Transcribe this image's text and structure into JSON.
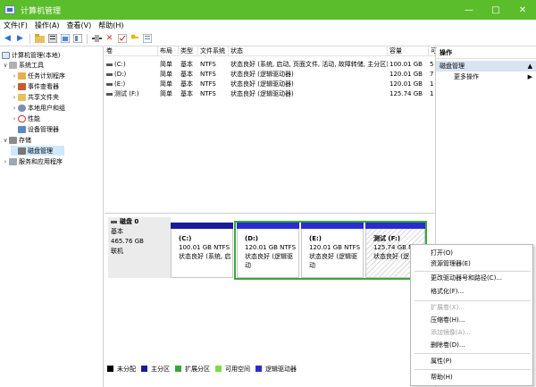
{
  "window": {
    "title": "计算机管理",
    "buttons": {
      "minimize": "—",
      "maximize": "□",
      "close": "✕"
    }
  },
  "menu": [
    "文件(F)",
    "操作(A)",
    "查看(V)",
    "帮助(H)"
  ],
  "toolbar_icons": [
    "back-arrow-icon",
    "forward-arrow-icon",
    "up-folder-icon",
    "properties-icon",
    "help-icon",
    "view-icon",
    "connect-icon",
    "delete-icon",
    "checklist-icon",
    "key-icon",
    "view-list-icon"
  ],
  "tree": {
    "items": [
      {
        "label": "计算机管理(本地)",
        "level": 0
      },
      {
        "label": "系统工具",
        "level": 1,
        "caret": "∨"
      },
      {
        "label": "任务计划程序",
        "level": 2,
        "caret": "›"
      },
      {
        "label": "事件查看器",
        "level": 2,
        "caret": "›"
      },
      {
        "label": "共享文件夹",
        "level": 2,
        "caret": "›"
      },
      {
        "label": "本地用户和组",
        "level": 2,
        "caret": "›"
      },
      {
        "label": "性能",
        "level": 2,
        "caret": "›"
      },
      {
        "label": "设备管理器",
        "level": 2,
        "caret": ""
      },
      {
        "label": "存储",
        "level": 1,
        "caret": "∨"
      },
      {
        "label": "磁盘管理",
        "level": 2,
        "caret": ""
      },
      {
        "label": "服务和应用程序",
        "level": 1,
        "caret": "›"
      }
    ]
  },
  "volumes": {
    "headers": [
      "卷",
      "布局",
      "类型",
      "文件系统",
      "状态",
      "容量",
      "可"
    ],
    "rows": [
      [
        "(C:)",
        "简单",
        "基本",
        "NTFS",
        "状态良好 (系统, 启动, 页面文件, 活动, 故障转储, 主分区)",
        "100.01 GB",
        "5"
      ],
      [
        "(D:)",
        "简单",
        "基本",
        "NTFS",
        "状态良好 (逻辑驱动器)",
        "120.01 GB",
        "7"
      ],
      [
        "(E:)",
        "简单",
        "基本",
        "NTFS",
        "状态良好 (逻辑驱动器)",
        "120.01 GB",
        "1"
      ],
      [
        "测试 (F:)",
        "简单",
        "基本",
        "NTFS",
        "状态良好 (逻辑驱动器)",
        "125.74 GB",
        "1"
      ]
    ]
  },
  "actions": {
    "header": "操作",
    "section": "磁盘管理",
    "more": "更多操作"
  },
  "disk": {
    "name": "磁盘 0",
    "type": "基本",
    "size": "465.76 GB",
    "status": "联机",
    "partitions": [
      {
        "name": "(C:)",
        "size": "100.01 GB NTFS",
        "status": "状态良好 (系统, 启"
      },
      {
        "name": "(D:)",
        "size": "120.01 GB NTFS",
        "status": "状态良好 (逻辑驱动"
      },
      {
        "name": "(E:)",
        "size": "120.01 GB NTFS",
        "status": "状态良好 (逻辑驱动"
      },
      {
        "name": "测试 (F:)",
        "size": "125.74 GB N",
        "status": "状态良好 (逻"
      }
    ]
  },
  "legend": [
    {
      "label": "未分配",
      "color": "#000000"
    },
    {
      "label": "主分区",
      "color": "#1a1a9a"
    },
    {
      "label": "扩展分区",
      "color": "#3aa63a"
    },
    {
      "label": "可用空间",
      "color": "#80d94a"
    },
    {
      "label": "逻辑驱动器",
      "color": "#2b2bd1"
    }
  ],
  "context_menu": {
    "items": [
      {
        "label": "打开(O)",
        "disabled": false
      },
      {
        "label": "资源管理器(E)",
        "disabled": false
      },
      {
        "label": "更改驱动器号和路径(C)...",
        "disabled": false
      },
      {
        "label": "格式化(F)...",
        "disabled": false
      },
      {
        "label": "扩展卷(X)...",
        "disabled": true
      },
      {
        "label": "压缩卷(H)...",
        "disabled": false
      },
      {
        "label": "添加镜像(A)...",
        "disabled": true
      },
      {
        "label": "删除卷(D)...",
        "disabled": false
      },
      {
        "label": "属性(P)",
        "disabled": false
      },
      {
        "label": "帮助(H)",
        "disabled": false
      }
    ]
  },
  "colors": {
    "titlebar": "#5bbd2b",
    "primary_partition": "#1a1a9a",
    "extended_partition": "#3aa63a",
    "selected": "#cde8ff"
  }
}
